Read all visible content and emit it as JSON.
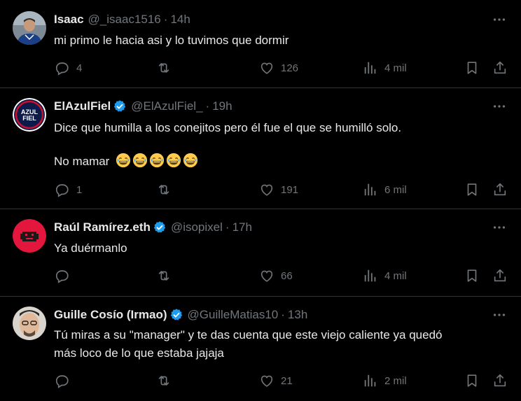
{
  "tweets": [
    {
      "name": "Isaac",
      "verified": false,
      "handle": "@_isaac1516",
      "time": "14h",
      "text": [
        "mi primo le hacia asi y lo tuvimos que dormir"
      ],
      "replies": "4",
      "retweets": "",
      "likes": "126",
      "views": "4 mil"
    },
    {
      "name": "ElAzulFiel",
      "verified": true,
      "handle": "@ElAzulFiel_",
      "time": "19h",
      "text": [
        "Dice que humilla a los conejitos pero él fue el que se humilló solo.",
        "No mamar"
      ],
      "replies": "1",
      "retweets": "",
      "likes": "191",
      "views": "6 mil"
    },
    {
      "name": "Raúl Ramírez.eth",
      "verified": true,
      "handle": "@isopixel",
      "time": "17h",
      "text": [
        "Ya duérmanlo"
      ],
      "replies": "",
      "retweets": "",
      "likes": "66",
      "views": "4 mil"
    },
    {
      "name": "Guille Cosío (Irmao)",
      "verified": true,
      "handle": "@GuilleMatias10",
      "time": "13h",
      "text": [
        "Tú miras a su \"manager\" y te das cuenta que este viejo caliente ya quedó",
        "más loco de lo que estaba jajaja"
      ],
      "replies": "",
      "retweets": "",
      "likes": "21",
      "views": "2 mil"
    }
  ],
  "avatars": {
    "elazulfiel_logo_text": "AZUL FIEL"
  },
  "separator": "·",
  "colors": {
    "verified": "#1d9bf0",
    "muted": "#71767b",
    "text": "#e7e9ea",
    "border": "#2f3336"
  }
}
